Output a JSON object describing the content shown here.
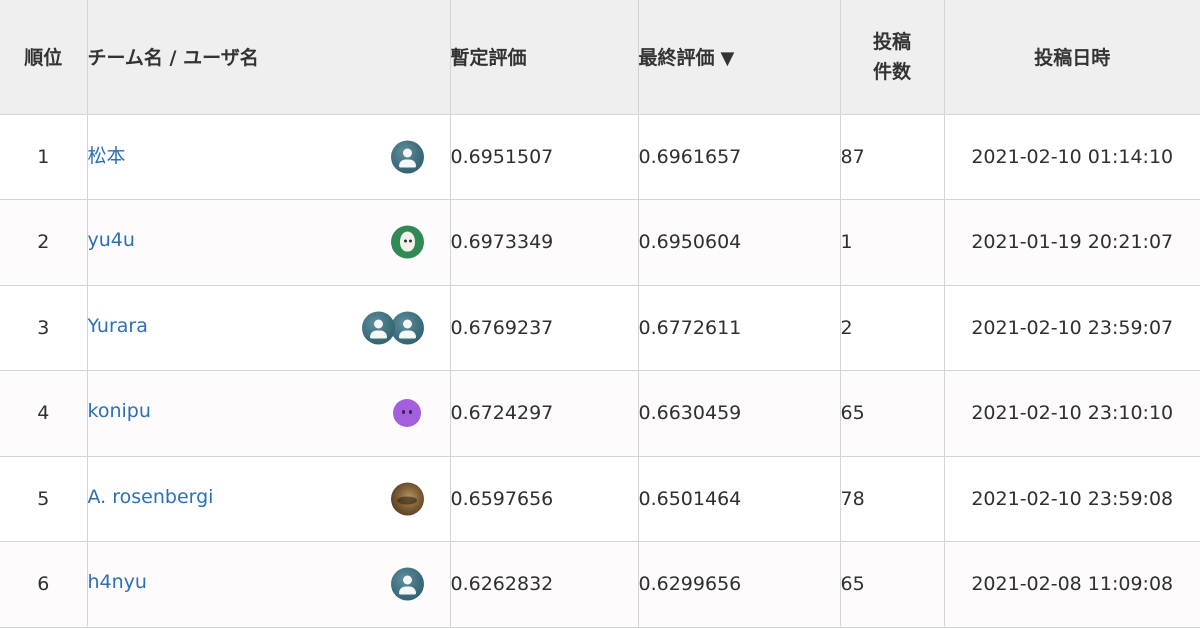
{
  "header": {
    "rank": "順位",
    "team": "チーム名 / ユーザ名",
    "provisional": "暫定評価",
    "final": "最終評価",
    "sort_arrow": "▼",
    "posts_line1": "投稿",
    "posts_line2": "件数",
    "date": "投稿日時"
  },
  "rows": [
    {
      "rank": "1",
      "team": "松本",
      "provisional": "0.6951507",
      "final": "0.6961657",
      "posts": "87",
      "date": "2021-02-10 01:14:10",
      "avatars": [
        "default-avatar-icon"
      ]
    },
    {
      "rank": "2",
      "team": "yu4u",
      "provisional": "0.6973349",
      "final": "0.6950604",
      "posts": "1",
      "date": "2021-01-19 20:21:07",
      "avatars": [
        "green-face-avatar-icon"
      ]
    },
    {
      "rank": "3",
      "team": "Yurara",
      "provisional": "0.6769237",
      "final": "0.6772611",
      "posts": "2",
      "date": "2021-02-10 23:59:07",
      "avatars": [
        "default-avatar-icon",
        "default-avatar-icon"
      ]
    },
    {
      "rank": "4",
      "team": "konipu",
      "provisional": "0.6724297",
      "final": "0.6630459",
      "posts": "65",
      "date": "2021-02-10 23:10:10",
      "avatars": [
        "purple-face-avatar-icon"
      ]
    },
    {
      "rank": "5",
      "team": "A. rosenbergi",
      "provisional": "0.6597656",
      "final": "0.6501464",
      "posts": "78",
      "date": "2021-02-10 23:59:08",
      "avatars": [
        "photo-avatar-icon"
      ]
    },
    {
      "rank": "6",
      "team": "h4nyu",
      "provisional": "0.6262832",
      "final": "0.6299656",
      "posts": "65",
      "date": "2021-02-08 11:09:08",
      "avatars": [
        "default-avatar-icon"
      ]
    }
  ],
  "colors": {
    "header_bg": "#efefef",
    "link": "#2b6fb8",
    "border": "#d4d4d4",
    "text": "#2f2f2f"
  }
}
